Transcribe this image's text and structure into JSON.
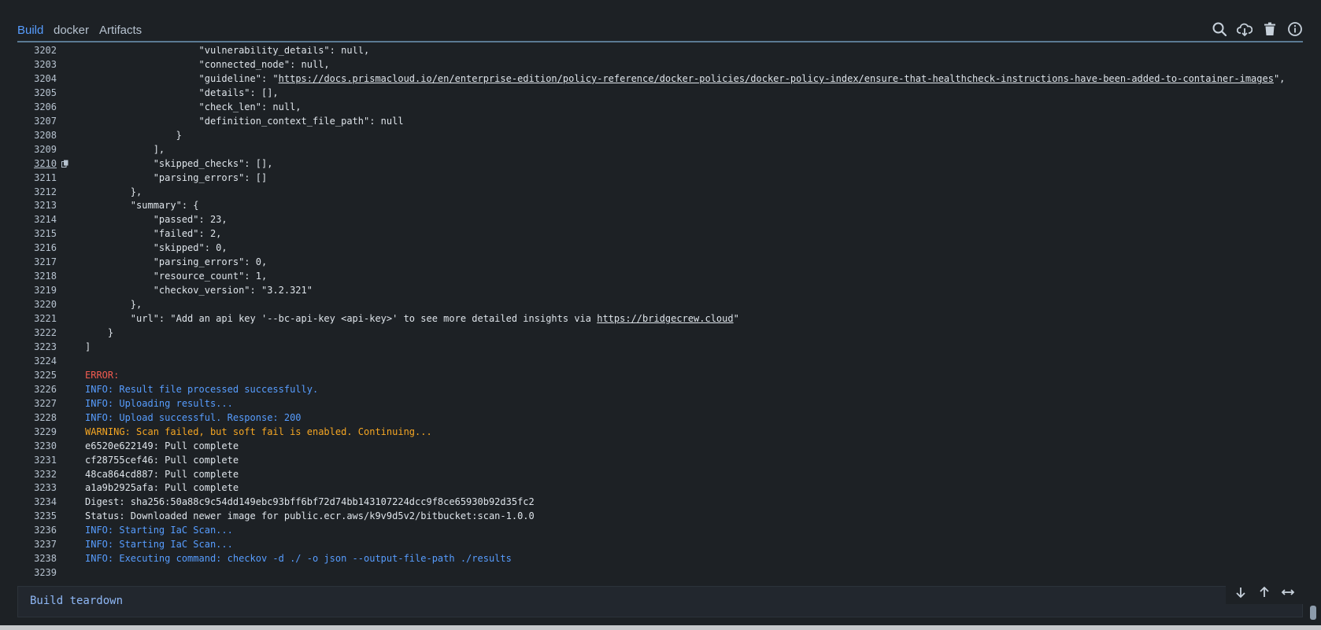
{
  "tabs": [
    {
      "label": "Build",
      "active": true
    },
    {
      "label": "docker",
      "active": false
    },
    {
      "label": "Artifacts",
      "active": false
    }
  ],
  "toolbar": [
    {
      "name": "search-icon"
    },
    {
      "name": "download-icon"
    },
    {
      "name": "trash-icon"
    },
    {
      "name": "info-icon"
    }
  ],
  "log": {
    "lines": [
      {
        "n": "3202",
        "text": "                    \"vulnerability_details\": null,",
        "type": "normal"
      },
      {
        "n": "3203",
        "text": "                    \"connected_node\": null,",
        "type": "normal"
      },
      {
        "n": "3204",
        "pre": "                    \"guideline\": \"",
        "link": "https://docs.prismacloud.io/en/enterprise-edition/policy-reference/docker-policies/docker-policy-index/ensure-that-healthcheck-instructions-have-been-added-to-container-images",
        "post": "\",",
        "type": "link"
      },
      {
        "n": "3205",
        "text": "                    \"details\": [],",
        "type": "normal"
      },
      {
        "n": "3206",
        "text": "                    \"check_len\": null,",
        "type": "normal"
      },
      {
        "n": "3207",
        "text": "                    \"definition_context_file_path\": null",
        "type": "normal"
      },
      {
        "n": "3208",
        "text": "                }",
        "type": "normal"
      },
      {
        "n": "3209",
        "text": "            ],",
        "type": "normal"
      },
      {
        "n": "3210",
        "text": "            \"skipped_checks\": [],",
        "type": "normal",
        "current": true
      },
      {
        "n": "3211",
        "text": "            \"parsing_errors\": []",
        "type": "normal"
      },
      {
        "n": "3212",
        "text": "        },",
        "type": "normal"
      },
      {
        "n": "3213",
        "text": "        \"summary\": {",
        "type": "normal"
      },
      {
        "n": "3214",
        "text": "            \"passed\": 23,",
        "type": "normal"
      },
      {
        "n": "3215",
        "text": "            \"failed\": 2,",
        "type": "normal"
      },
      {
        "n": "3216",
        "text": "            \"skipped\": 0,",
        "type": "normal"
      },
      {
        "n": "3217",
        "text": "            \"parsing_errors\": 0,",
        "type": "normal"
      },
      {
        "n": "3218",
        "text": "            \"resource_count\": 1,",
        "type": "normal"
      },
      {
        "n": "3219",
        "text": "            \"checkov_version\": \"3.2.321\"",
        "type": "normal"
      },
      {
        "n": "3220",
        "text": "        },",
        "type": "normal"
      },
      {
        "n": "3221",
        "pre": "        \"url\": \"Add an api key '--bc-api-key <api-key>' to see more detailed insights via ",
        "link": "https://bridgecrew.cloud",
        "post": "\"",
        "type": "link"
      },
      {
        "n": "3222",
        "text": "    }",
        "type": "normal"
      },
      {
        "n": "3223",
        "text": "]",
        "type": "normal"
      },
      {
        "n": "3224",
        "text": "",
        "type": "normal"
      },
      {
        "n": "3225",
        "text": "ERROR:",
        "type": "error"
      },
      {
        "n": "3226",
        "text": "INFO: Result file processed successfully.",
        "type": "info"
      },
      {
        "n": "3227",
        "text": "INFO: Uploading results...",
        "type": "info"
      },
      {
        "n": "3228",
        "text": "INFO: Upload successful. Response: 200",
        "type": "info"
      },
      {
        "n": "3229",
        "text": "WARNING: Scan failed, but soft fail is enabled. Continuing...",
        "type": "warning"
      },
      {
        "n": "3230",
        "text": "e6520e622149: Pull complete",
        "type": "normal"
      },
      {
        "n": "3231",
        "text": "cf28755cef46: Pull complete",
        "type": "normal"
      },
      {
        "n": "3232",
        "text": "48ca864cd887: Pull complete",
        "type": "normal"
      },
      {
        "n": "3233",
        "text": "a1a9b2925afa: Pull complete",
        "type": "normal"
      },
      {
        "n": "3234",
        "text": "Digest: sha256:50a88c9c54dd149ebc93bff6bf72d74bb143107224dcc9f8ce65930b92d35fc2",
        "type": "normal"
      },
      {
        "n": "3235",
        "text": "Status: Downloaded newer image for public.ecr.aws/k9v9d5v2/bitbucket:scan-1.0.0",
        "type": "normal"
      },
      {
        "n": "3236",
        "text": "INFO: Starting IaC Scan...",
        "type": "info"
      },
      {
        "n": "3237",
        "text": "INFO: Starting IaC Scan...",
        "type": "info"
      },
      {
        "n": "3238",
        "text": "INFO: Executing command: checkov -d ./ -o json --output-file-path ./results",
        "type": "info"
      },
      {
        "n": "3239",
        "text": "",
        "type": "normal"
      }
    ]
  },
  "teardown": {
    "label": "Build teardown"
  },
  "scroll_controls": [
    {
      "name": "scroll-down-icon"
    },
    {
      "name": "scroll-up-icon"
    },
    {
      "name": "wrap-toggle-icon"
    }
  ]
}
